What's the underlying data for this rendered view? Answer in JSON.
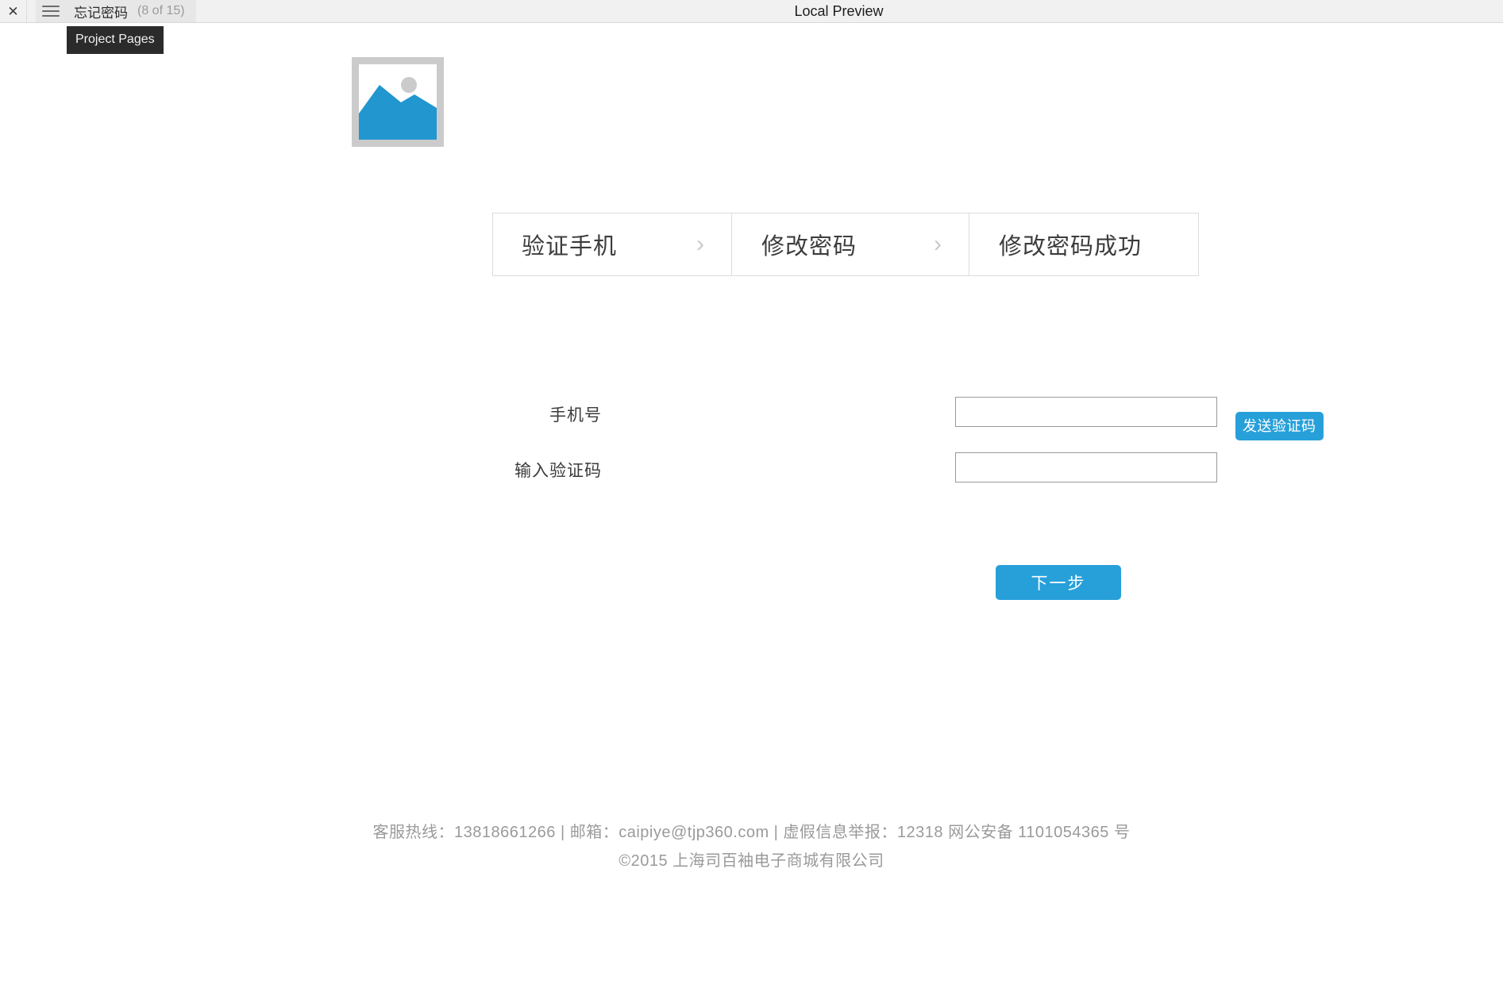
{
  "toolbar": {
    "close_icon": "close-icon",
    "menu_icon": "hamburger-icon",
    "page_name": "忘记密码",
    "page_count": "(8 of 15)",
    "window_title": "Local Preview",
    "tooltip": "Project Pages"
  },
  "page": {
    "logo_alt": "image-placeholder-icon",
    "stepper": [
      {
        "label": "验证手机",
        "chevron": "›",
        "has_chevron": true
      },
      {
        "label": "修改密码",
        "chevron": "›",
        "has_chevron": true
      },
      {
        "label": "修改密码成功",
        "chevron": "",
        "has_chevron": false
      }
    ],
    "form": {
      "phone_label": "手机号",
      "phone_value": "",
      "phone_placeholder": "",
      "code_label": "输入验证码",
      "code_value": "",
      "code_placeholder": "",
      "send_code_label": "发送验证码",
      "next_label": "下一步"
    },
    "footer": {
      "line1": "客服热线：13818661266 | 邮箱：caipiye@tjp360.com | 虚假信息举报：12318 网公安备 1101054365 号",
      "line2": "©2015 上海司百袖电子商城有限公司"
    }
  },
  "colors": {
    "accent": "#27A0DA",
    "toolbar_bg": "#F1F1F1",
    "border": "#DDDDDD",
    "muted_text": "#9A9A9A"
  }
}
